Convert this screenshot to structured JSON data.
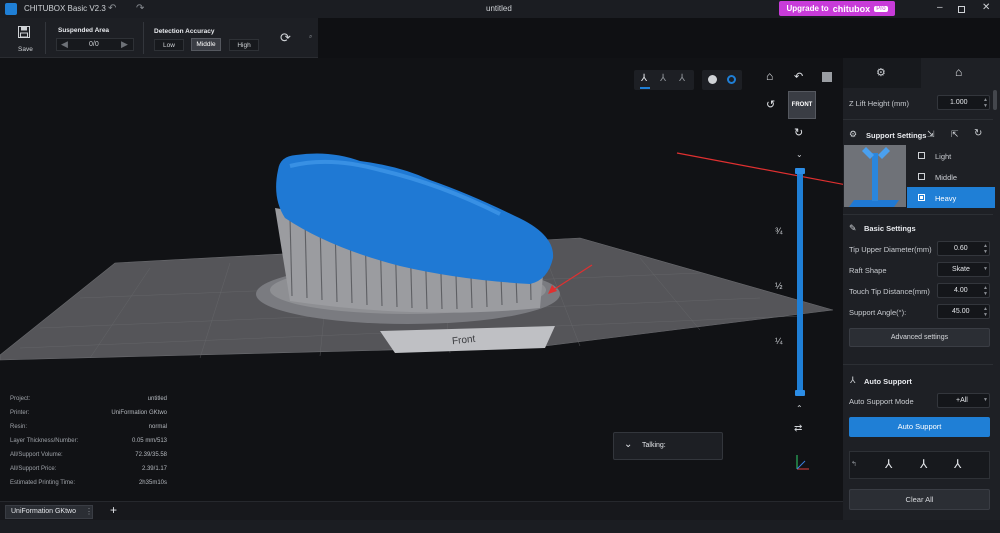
{
  "app": {
    "title": "CHITUBOX Basic V2.3",
    "document": "untitled",
    "upgrade_label": "Upgrade to",
    "upgrade_brand": "chitubox",
    "upgrade_badge": "Pro"
  },
  "toolbar": {
    "save_label": "Save",
    "suspended_area": {
      "title": "Suspended Area",
      "value": "0/0"
    },
    "detection_accuracy": {
      "title": "Detection Accuracy",
      "options": [
        "Low",
        "Middle",
        "High"
      ],
      "selected": "Middle"
    }
  },
  "viewport": {
    "view_modes": [
      "support-view-1",
      "support-view-2",
      "support-view-3"
    ],
    "cube_face": "FRONT",
    "plate_label": "Front",
    "slider_marks": [
      "¾",
      "½",
      "¼"
    ],
    "talking_label": "Talking:"
  },
  "info": {
    "rows": [
      {
        "label": "Project:",
        "value": "untitled"
      },
      {
        "label": "Printer:",
        "value": "UniFormation GKtwo"
      },
      {
        "label": "Resin:",
        "value": "normal"
      },
      {
        "label": "Layer Thickness/Number:",
        "value": "0.05 mm/513"
      },
      {
        "label": "All/Support Volume:",
        "value": "72.39/35.58"
      },
      {
        "label": "All/Support Price:",
        "value": "2.39/1.17"
      },
      {
        "label": "Estimated Printing Time:",
        "value": "2h35m10s"
      }
    ]
  },
  "bottombar": {
    "printer_tab": "UniFormation GKtwo",
    "add": "+"
  },
  "panel": {
    "z_lift": {
      "label": "Z Lift Height (mm)",
      "value": "1.000"
    },
    "support_settings": {
      "title": "Support Settings",
      "presets": [
        "Light",
        "Middle",
        "Heavy"
      ],
      "selected": "Heavy"
    },
    "basic_settings": {
      "title": "Basic Settings",
      "fields": [
        {
          "label": "Tip Upper Diameter(mm)",
          "value": "0.60"
        },
        {
          "label": "Raft Shape",
          "value": "Skate"
        },
        {
          "label": "Touch Tip Distance(mm)",
          "value": "4.00"
        },
        {
          "label": "Support Angle(°):",
          "value": "45.00"
        }
      ],
      "advanced_label": "Advanced settings"
    },
    "auto_support": {
      "title": "Auto Support",
      "mode_label": "Auto Support Mode",
      "mode_value": "+All",
      "button_label": "Auto Support"
    },
    "clear_all_label": "Clear All"
  },
  "colors": {
    "accent": "#1f7fd6",
    "model": "#1f79d4",
    "upgrade": "#c83bd9",
    "arrow": "#e03030"
  }
}
